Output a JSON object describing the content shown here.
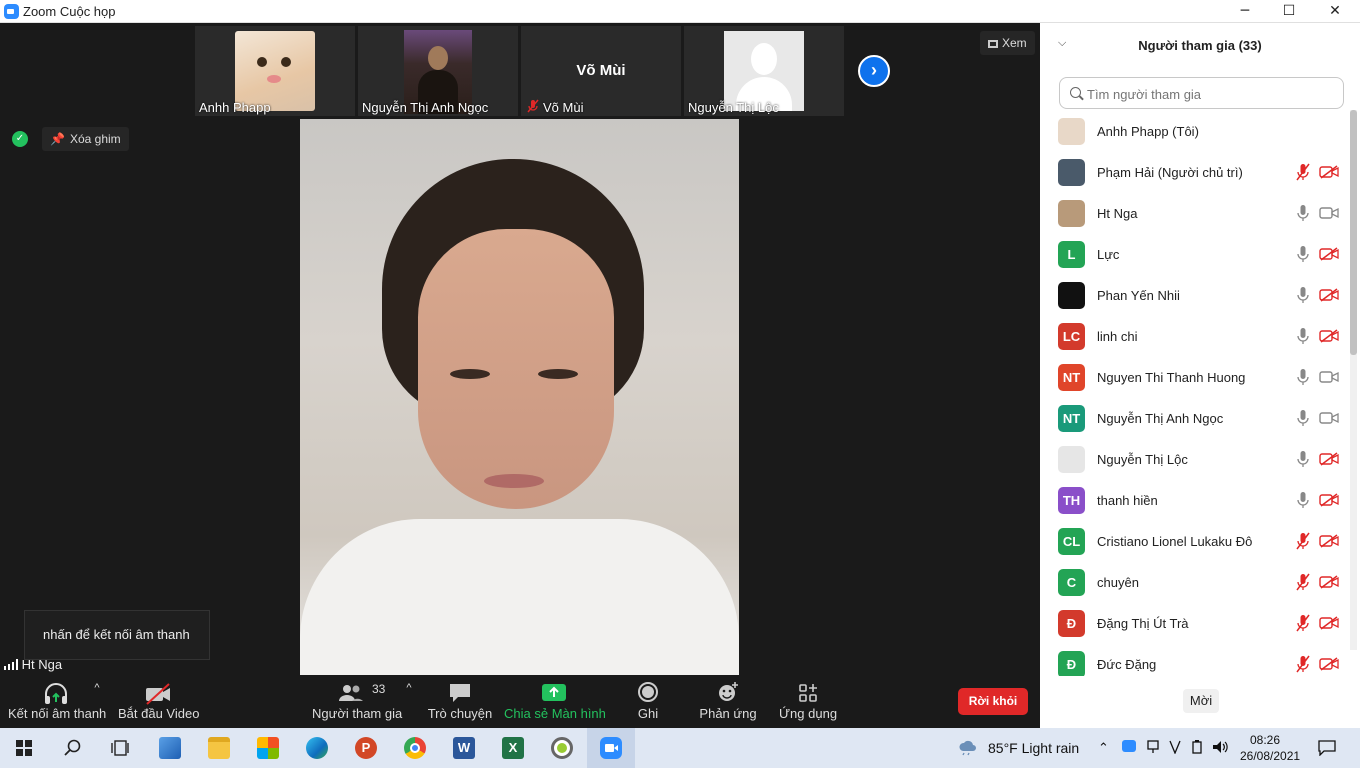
{
  "window": {
    "title": "Zoom Cuộc họp",
    "minimize": "─",
    "maximize": "☐",
    "close": "✕"
  },
  "stage": {
    "thumbnails": [
      {
        "name": "Anhh Phapp"
      },
      {
        "name": "Nguyễn Thị Anh Ngọc"
      },
      {
        "name": "Võ Mùi",
        "display": "Võ Mùi"
      },
      {
        "name": "Nguyễn Thị Lộc"
      }
    ],
    "next_arrow": "›",
    "view_label": "Xem",
    "unpin_label": "Xóa ghim",
    "audio_tooltip": "nhấn để kết nối âm thanh",
    "speaker_label": "Ht Nga"
  },
  "toolbar": {
    "audio": "Kết nối âm thanh",
    "video": "Bắt đầu Video",
    "participants": "Người tham gia",
    "participants_count": "33",
    "chat": "Trò chuyện",
    "share": "Chia sẻ Màn hình",
    "record": "Ghi",
    "reactions": "Phản ứng",
    "apps": "Ứng dụng",
    "leave": "Rời khỏi",
    "caret": "^"
  },
  "panel": {
    "title": "Người tham gia (33)",
    "collapse": "⌵",
    "search_placeholder": "Tìm người tham gia",
    "invite": "Mời",
    "participants": [
      {
        "name": "Anhh Phapp (Tôi)",
        "avatar_text": "",
        "avatar_color": "#e8d8c8",
        "mic": "none",
        "cam": "none"
      },
      {
        "name": "Phạm Hải (Người chủ trì)",
        "avatar_text": "",
        "avatar_color": "#4a5a6a",
        "mic": "muted",
        "cam": "off"
      },
      {
        "name": "Ht Nga",
        "avatar_text": "",
        "avatar_color": "#b89a7a",
        "mic": "on",
        "cam": "on"
      },
      {
        "name": "Lực",
        "avatar_text": "L",
        "avatar_color": "#23a455",
        "mic": "on",
        "cam": "off"
      },
      {
        "name": "Phan Yến Nhii",
        "avatar_text": "",
        "avatar_color": "#111111",
        "mic": "on",
        "cam": "off"
      },
      {
        "name": "linh chi",
        "avatar_text": "LC",
        "avatar_color": "#d33a2c",
        "mic": "on",
        "cam": "off"
      },
      {
        "name": "Nguyen Thi Thanh Huong",
        "avatar_text": "NT",
        "avatar_color": "#e0452a",
        "mic": "on",
        "cam": "on"
      },
      {
        "name": "Nguyễn Thị Anh Ngọc",
        "avatar_text": "NT",
        "avatar_color": "#1a9a7a",
        "mic": "on",
        "cam": "on"
      },
      {
        "name": "Nguyễn Thị Lộc",
        "avatar_text": "",
        "avatar_color": "#e6e6e6",
        "mic": "on",
        "cam": "off"
      },
      {
        "name": "thanh hiền",
        "avatar_text": "TH",
        "avatar_color": "#8a4fc9",
        "mic": "on",
        "cam": "off"
      },
      {
        "name": "Cristiano Lionel Lukaku Đô",
        "avatar_text": "CL",
        "avatar_color": "#23a455",
        "mic": "muted",
        "cam": "off"
      },
      {
        "name": "chuyên",
        "avatar_text": "C",
        "avatar_color": "#23a455",
        "mic": "muted",
        "cam": "off"
      },
      {
        "name": "Đặng Thị Út Trà",
        "avatar_text": "Đ",
        "avatar_color": "#d33a2c",
        "mic": "muted",
        "cam": "off"
      },
      {
        "name": "Đức Đặng",
        "avatar_text": "Đ",
        "avatar_color": "#23a455",
        "mic": "muted",
        "cam": "off"
      }
    ]
  },
  "taskbar": {
    "weather": "85°F  Light rain",
    "time": "08:26",
    "date": "26/08/2021",
    "apps": [
      "start-icon",
      "search-icon",
      "task-view-icon",
      "photos-icon",
      "file-explorer-icon",
      "store-icon",
      "edge-icon",
      "powerpoint-icon",
      "chrome-icon",
      "word-icon",
      "excel-icon",
      "geogebra-icon",
      "zoom-icon"
    ]
  }
}
